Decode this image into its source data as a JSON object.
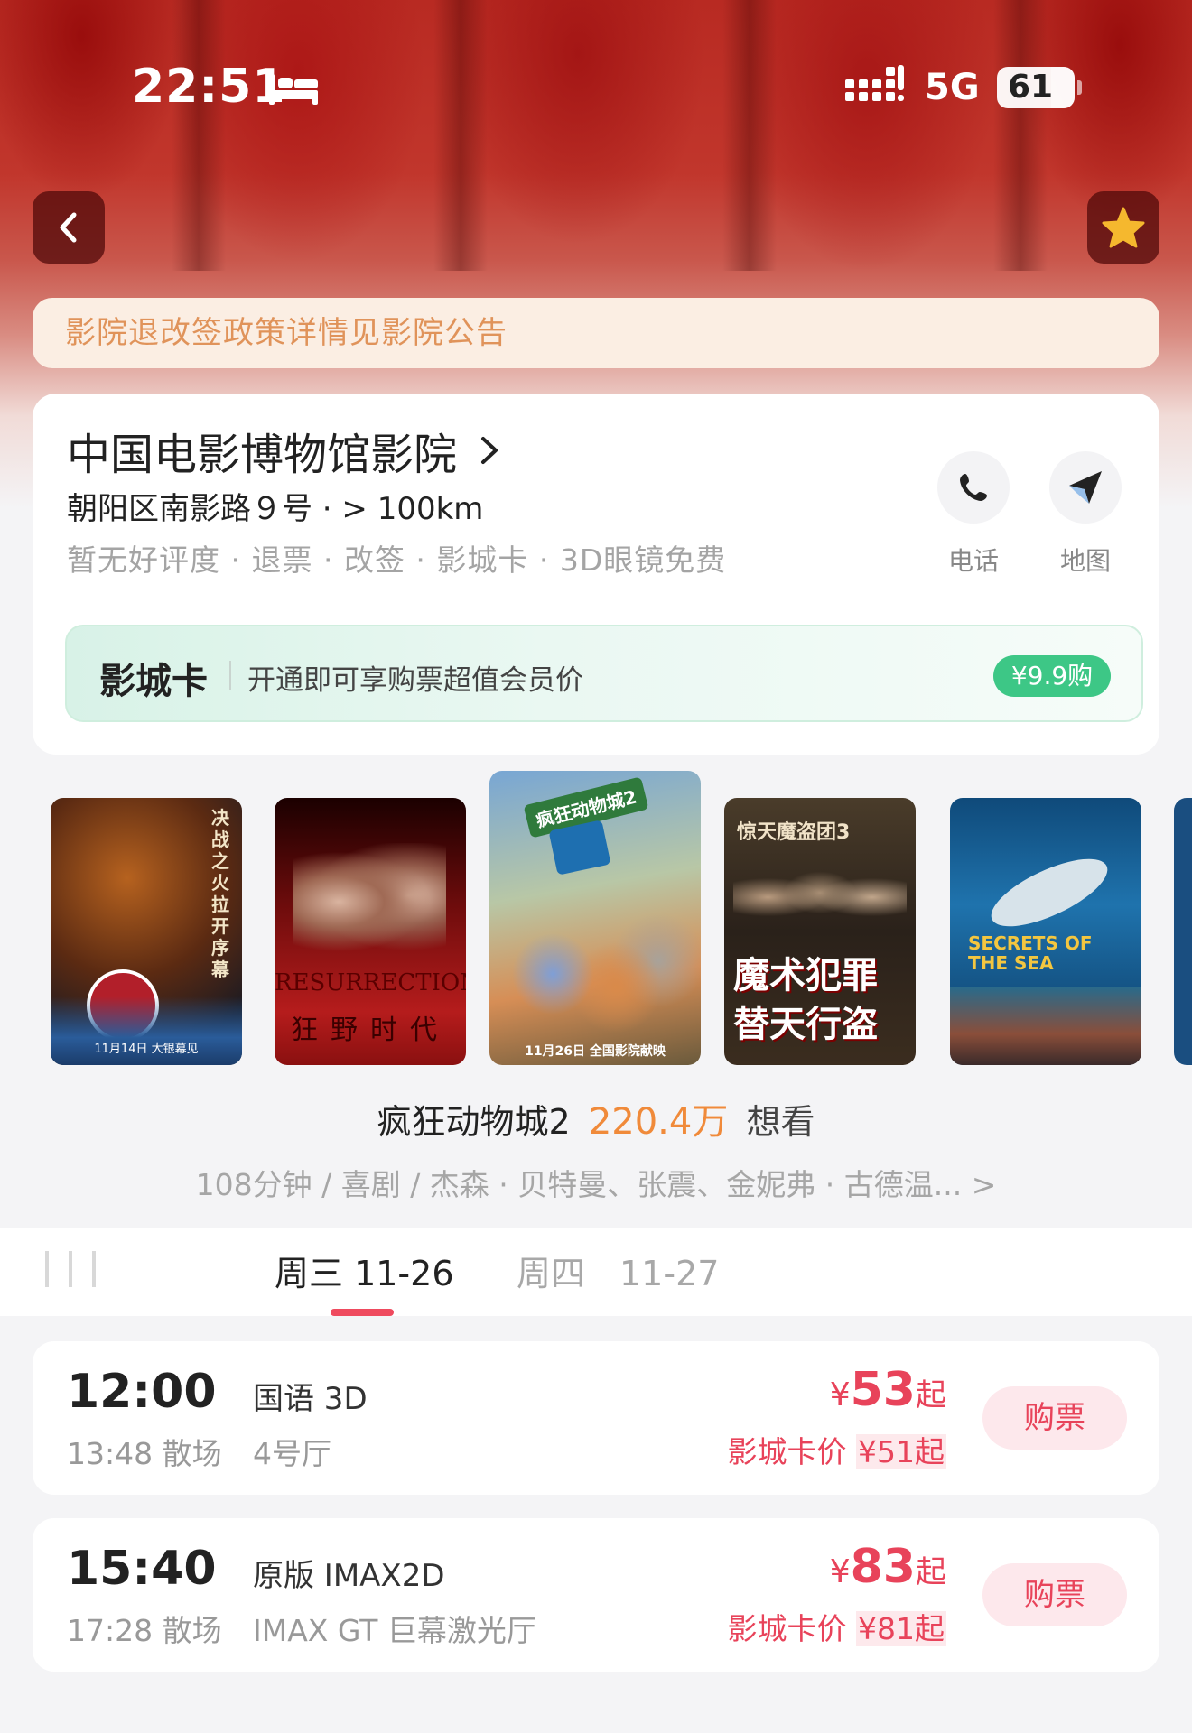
{
  "status_bar": {
    "time": "22:51",
    "network": "5G",
    "battery": "61",
    "icons": [
      "bed-icon",
      "signal-icon",
      "battery-icon"
    ]
  },
  "nav": {
    "back_icon": "chevron-left-icon",
    "favorite_icon": "star-icon",
    "favorite_color": "#f5b82e"
  },
  "notice": "影院退改签政策详情见影院公告",
  "cinema": {
    "name": "中国电影博物馆影院",
    "address": "朝阳区南影路９号 · > 100km",
    "tags": "暂无好评度 · 退票 · 改签 · 影城卡 · 3D眼镜免费",
    "actions": [
      {
        "label": "电话",
        "icon": "phone-icon"
      },
      {
        "label": "地图",
        "icon": "navigation-arrow-icon"
      }
    ]
  },
  "card_promo": {
    "title": "影城卡",
    "description": "开通即可享购票超值会员价",
    "button": "¥9.9购",
    "accent": "#3dc786"
  },
  "posters": [
    {
      "overlay": "决战之火拉开序幕",
      "icon": "poster-demon-slayer",
      "footer": "11月14日 大银幕见"
    },
    {
      "overlay": "RESURRECTION",
      "icon": "poster-resurrection",
      "footer": "狂野时代"
    },
    {
      "overlay": "疯狂动物城2",
      "icon": "poster-zootopia-2",
      "footer": "11月26日 全国影院献映",
      "selected": true
    },
    {
      "overlay": "惊天魔盗团3",
      "icon": "poster-now-you-see-me-3",
      "footer": "魔术犯罪 替天行盗"
    },
    {
      "overlay": "SECRETS OF THE SEA",
      "icon": "poster-secrets-of-the-sea",
      "footer": ""
    }
  ],
  "selected_movie": {
    "title": "疯狂动物城2",
    "want_count": "220.4万",
    "want_label": "想看",
    "meta": "108分钟 / 喜剧 / 杰森 · 贝特曼、张震、金妮弗 · 古德温... >"
  },
  "date_tabs": [
    {
      "label": "周三 11-26",
      "active": true
    },
    {
      "label": "周四　11-27",
      "active": false
    }
  ],
  "showtimes": [
    {
      "start": "12:00",
      "end": "13:48 散场",
      "version": "国语 3D",
      "hall": "4号厅",
      "yen": "¥",
      "price": "53",
      "price_suffix": "起",
      "card_price_label": "影城卡价",
      "card_price": "¥51起",
      "buy_label": "购票"
    },
    {
      "start": "15:40",
      "end": "17:28 散场",
      "version": "原版 IMAX2D",
      "hall": "IMAX GT 巨幕激光厅",
      "yen": "¥",
      "price": "83",
      "price_suffix": "起",
      "card_price_label": "影城卡价",
      "card_price": "¥81起",
      "buy_label": "购票"
    }
  ],
  "colors": {
    "price_red": "#e8435a",
    "notice_text": "#e0935a",
    "hot_orange": "#f08a3a"
  }
}
